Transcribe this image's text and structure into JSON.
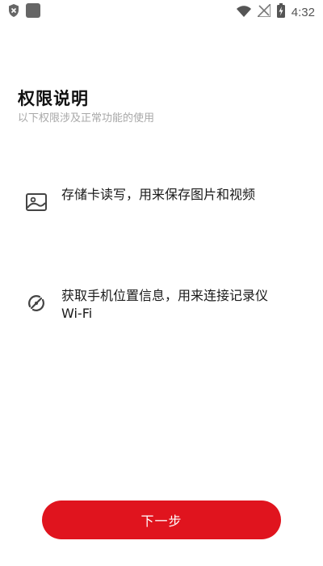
{
  "status_bar": {
    "time": "4:32",
    "left_icons": [
      "shield-x-icon",
      "app-square-icon"
    ],
    "right_icons": [
      "wifi-icon",
      "no-signal-icon",
      "battery-charging-icon"
    ]
  },
  "header": {
    "title": "权限说明",
    "subtitle": "以下权限涉及正常功能的使用"
  },
  "permissions": [
    {
      "icon": "image-icon",
      "text": "存储卡读写，用来保存图片和视频"
    },
    {
      "icon": "wifi-link-icon",
      "text": "获取手机位置信息，用来连接记录仪Wi-Fi"
    }
  ],
  "footer": {
    "next_label": "下一步"
  },
  "colors": {
    "accent": "#e0141e",
    "title": "#111111",
    "subtitle": "#a8a8a8",
    "icon": "#444444"
  }
}
